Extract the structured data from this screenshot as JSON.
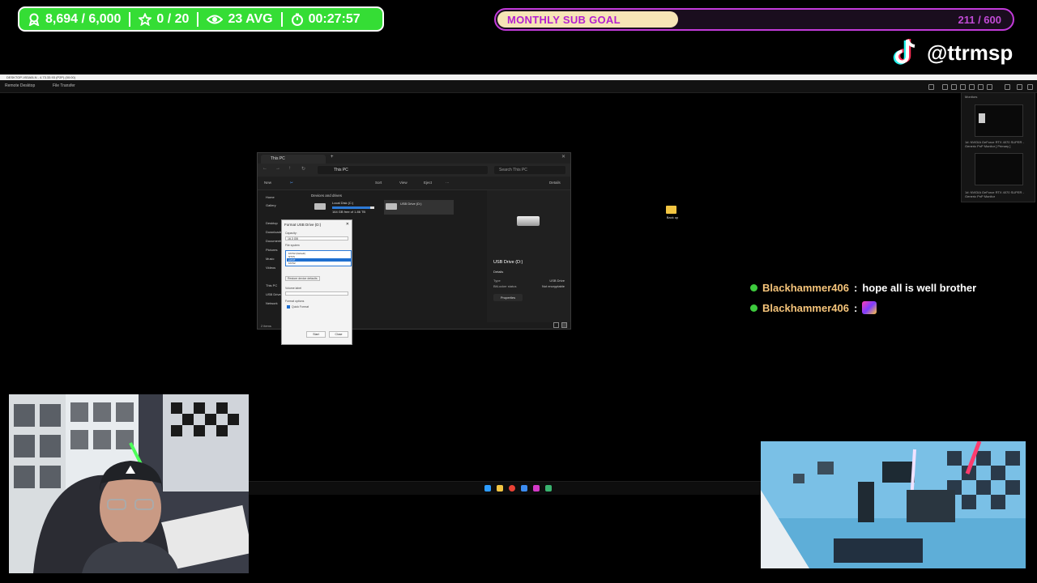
{
  "overlay": {
    "stats": {
      "followers": "8,694 / 6,000",
      "favorites": "0 / 20",
      "viewers": "23 AVG",
      "uptime": "00:27:57"
    },
    "goal": {
      "title": "MONTHLY SUB GOAL",
      "count": "211 / 600",
      "progress": 0.35
    },
    "social": {
      "handle": "@ttrmsp",
      "icon": "tiktok-icon"
    }
  },
  "remote_desktop": {
    "window_title": "DESKTOP-V53A0LN - 4.73.33.93 (P2P) (00:00)",
    "tabs": [
      "Remote Desktop",
      "File Transfer"
    ],
    "monitors": {
      "title": "Monitors",
      "primary": "1#: NVIDIA GeForce RTX 4070 SUPER - Generic PnP Monitor [ Primary ]",
      "secondary": "1#: NVIDIA GeForce RTX 4070 SUPER - Generic PnP Monitor"
    }
  },
  "explorer": {
    "tab_title": "This PC",
    "path": "This PC",
    "search_placeholder": "Search This PC",
    "toolbar": {
      "new": "New",
      "sort": "Sort",
      "view": "View",
      "eject": "Eject",
      "details": "Details"
    },
    "nav": [
      "Home",
      "Gallery",
      "Desktop",
      "Downloads",
      "Documents",
      "Pictures",
      "Music",
      "Videos",
      "This PC",
      "USB Drive",
      "Network"
    ],
    "section_header": "Devices and drives",
    "drives": [
      {
        "name": "Local Disk (C:)",
        "space": "164 GB free of 1.86 TB",
        "used_fraction": 0.91
      },
      {
        "name": "USB Drive (D:)",
        "space": "",
        "used_fraction": 0
      }
    ],
    "details_pane": {
      "title": "USB Drive (D:)",
      "section": "Details",
      "rows": [
        {
          "label": "Type",
          "value": "USB Drive"
        },
        {
          "label": "BitLocker status",
          "value": "Not encryptable"
        }
      ],
      "properties_label": "Properties"
    },
    "status": "2 items"
  },
  "format_dialog": {
    "title": "Format USB Drive (D:)",
    "capacity_label": "Capacity:",
    "capacity_value": "16.3 GB",
    "fs_label": "File system",
    "options": [
      "FAT32 (Default)",
      "NTFS",
      "exFAT",
      "FAT32"
    ],
    "selected_index": 2,
    "restore_label": "Restore device defaults",
    "volume_label": "Volume label",
    "format_options_label": "Format options",
    "quick_format": "Quick Format",
    "start": "Start",
    "close": "Close"
  },
  "desktop": {
    "folder_label": "Back up"
  },
  "chat": [
    {
      "user": "Blackhammer406",
      "message": "hope all is well brother"
    },
    {
      "user": "Blackhammer406",
      "message": ""
    }
  ],
  "colors": {
    "stats_bg": "#35dd35",
    "goal_border": "#c23ad9",
    "goal_fill": "#f6e5b6",
    "chat_user": "#f5c47a",
    "chat_badge": "#3ecb3e"
  }
}
